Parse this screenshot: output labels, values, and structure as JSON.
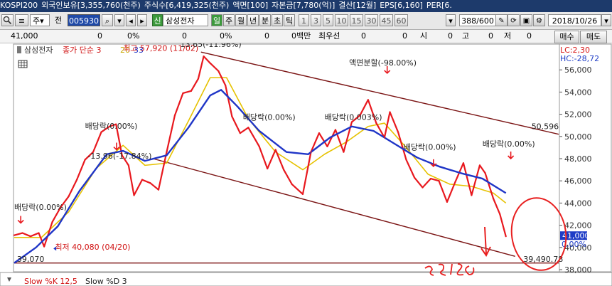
{
  "title_bar": {
    "segments": [
      "KOSPI200",
      "외국인보유[3,355,760(천주)",
      "주식수[6,419,325(천주)",
      "액면[100]",
      "자본금[7,780(억)]",
      "결산[12월]",
      "EPS[6,160]",
      "PER[6."
    ]
  },
  "toolbar": {
    "market_label": "주",
    "full_label": "전",
    "stock_code": "005930",
    "shin_badge": "신",
    "stock_name": "삼성전자",
    "periods": [
      "일",
      "주",
      "월",
      "년",
      "분",
      "초",
      "틱"
    ],
    "intervals": [
      "1",
      "3",
      "5",
      "10",
      "15",
      "30",
      "45",
      "60"
    ],
    "count": "388",
    "count_total": "/600",
    "date": "2018/10/26"
  },
  "quote_row": {
    "price": "41,000",
    "change": "0",
    "change_pct": "0%",
    "volume": "0",
    "volume_pct": "0%",
    "v2": "0",
    "amount": "0백만",
    "best_ask_label": "최우선",
    "best_ask": "0",
    "v3": "0",
    "open_label": "시",
    "open": "0",
    "high_label": "고",
    "high": "0",
    "low_label": "저",
    "low": "0",
    "buy_label": "매수",
    "sell_label": "매도"
  },
  "colors": {
    "price_line": "#e8181e",
    "ma20": "#e6c200",
    "ma33": "#1f35c7",
    "channel": "#7b1414",
    "annotation_red": "#e8181e",
    "lc": "#d81818",
    "hc": "#1e3cc6",
    "ink": "#e82020"
  },
  "chart_data": {
    "type": "line",
    "legend": {
      "name": "삼성전자",
      "series": "종가 단순 3",
      "ma_a": "20",
      "ma_b": "33"
    },
    "corner": {
      "lc": "LC:2,30",
      "hc": "HC:-28,72"
    },
    "y_ticks": [
      "56,000",
      "54,000",
      "52,000",
      "50,000",
      "48,000",
      "46,000",
      "44,000",
      "42,000",
      "40,000",
      "38,000"
    ],
    "current_price_tag": "41,000",
    "current_pct_tag": "0.00%",
    "x_range": [
      0,
      100
    ],
    "y_range": [
      38000,
      58000
    ],
    "close": [
      [
        0,
        41100
      ],
      [
        1.5,
        41300
      ],
      [
        3,
        41000
      ],
      [
        4.5,
        41300
      ],
      [
        5.5,
        40080
      ],
      [
        7,
        42300
      ],
      [
        8.5,
        43600
      ],
      [
        10,
        44600
      ],
      [
        11.5,
        46100
      ],
      [
        13,
        47900
      ],
      [
        14.5,
        48600
      ],
      [
        16,
        50400
      ],
      [
        17.5,
        50900
      ],
      [
        18.7,
        51100
      ],
      [
        19.8,
        48300
      ],
      [
        21,
        47400
      ],
      [
        22,
        44700
      ],
      [
        23.5,
        46100
      ],
      [
        25,
        45800
      ],
      [
        26.5,
        45200
      ],
      [
        28,
        48600
      ],
      [
        29.5,
        51900
      ],
      [
        31,
        53900
      ],
      [
        32.5,
        54100
      ],
      [
        33.8,
        55200
      ],
      [
        34.8,
        57220
      ],
      [
        36,
        56600
      ],
      [
        37.5,
        55900
      ],
      [
        38.8,
        54600
      ],
      [
        40,
        51800
      ],
      [
        41.5,
        50300
      ],
      [
        43,
        50800
      ],
      [
        45,
        49100
      ],
      [
        46.5,
        47100
      ],
      [
        48,
        48800
      ],
      [
        49.5,
        47000
      ],
      [
        51,
        45700
      ],
      [
        53,
        44800
      ],
      [
        54.5,
        48600
      ],
      [
        56,
        50300
      ],
      [
        57.5,
        49100
      ],
      [
        59,
        50600
      ],
      [
        60.5,
        48600
      ],
      [
        62,
        51300
      ],
      [
        63.5,
        51900
      ],
      [
        65,
        53300
      ],
      [
        66.5,
        51200
      ],
      [
        68,
        49900
      ],
      [
        69,
        52200
      ],
      [
        70.5,
        50400
      ],
      [
        72,
        47900
      ],
      [
        73.5,
        46300
      ],
      [
        75,
        45400
      ],
      [
        76.5,
        46200
      ],
      [
        78,
        46000
      ],
      [
        79.5,
        44100
      ],
      [
        81,
        45900
      ],
      [
        82.5,
        47600
      ],
      [
        84,
        44700
      ],
      [
        85.5,
        47400
      ],
      [
        86.5,
        46700
      ],
      [
        88,
        44400
      ],
      [
        89.2,
        43000
      ],
      [
        90.3,
        41000
      ]
    ],
    "ma20": [
      [
        0,
        40900
      ],
      [
        5,
        40900
      ],
      [
        10,
        43200
      ],
      [
        15,
        47100
      ],
      [
        20,
        49200
      ],
      [
        24,
        47400
      ],
      [
        28,
        47600
      ],
      [
        32,
        51400
      ],
      [
        36,
        55300
      ],
      [
        39,
        55300
      ],
      [
        43,
        51600
      ],
      [
        48,
        48600
      ],
      [
        53,
        47000
      ],
      [
        57,
        48400
      ],
      [
        61,
        49500
      ],
      [
        65,
        50900
      ],
      [
        68,
        51200
      ],
      [
        72,
        49000
      ],
      [
        76,
        46600
      ],
      [
        80,
        45700
      ],
      [
        84,
        45500
      ],
      [
        88,
        44900
      ],
      [
        90.3,
        44000
      ]
    ],
    "ma33": [
      [
        0,
        38600
      ],
      [
        4,
        40000
      ],
      [
        8,
        41900
      ],
      [
        12,
        45100
      ],
      [
        17,
        48400
      ],
      [
        20,
        48700
      ],
      [
        24,
        47800
      ],
      [
        28,
        48300
      ],
      [
        32,
        50800
      ],
      [
        36,
        53700
      ],
      [
        38,
        54200
      ],
      [
        41,
        52700
      ],
      [
        45,
        50500
      ],
      [
        50,
        48600
      ],
      [
        54,
        48400
      ],
      [
        58,
        49900
      ],
      [
        62,
        50900
      ],
      [
        66,
        50500
      ],
      [
        70,
        49300
      ],
      [
        74,
        48100
      ],
      [
        78,
        47300
      ],
      [
        82,
        46700
      ],
      [
        86,
        46200
      ],
      [
        90.3,
        44900
      ]
    ],
    "channel_upper": [
      [
        34.3,
        57600
      ],
      [
        100,
        50200
      ]
    ],
    "channel_lower_a": [
      [
        25.5,
        48000
      ],
      [
        92,
        39200
      ]
    ],
    "channel_lower_b": [
      [
        0,
        38600
      ],
      [
        100,
        38600
      ]
    ],
    "annotations": [
      {
        "text": "최고 57,920 (11/02)",
        "x": 20,
        "y": 57700
      },
      {
        "text": "13.65(-11.96%)",
        "x": 30.5,
        "y": 58050
      },
      {
        "text": "배당락(0.00%)",
        "x": 13,
        "y": 50700
      },
      {
        "text": "-13.96(-17.84%)",
        "x": 13.5,
        "y": 48000
      },
      {
        "text": "배당락(0.00%)",
        "x": 0,
        "y": 43400
      },
      {
        "text": "최저 40,080 (04/20)",
        "x": 7.5,
        "y": 39800
      },
      {
        "text": "39,070",
        "x": 0.5,
        "y": 38700
      },
      {
        "text": "액면분할(-98.00%)",
        "x": 61.5,
        "y": 56400
      },
      {
        "text": "배당락(0.00%)",
        "x": 42,
        "y": 51500
      },
      {
        "text": "배당락(0.003%)",
        "x": 57,
        "y": 51500
      },
      {
        "text": "배당락(0.00%)",
        "x": 71.5,
        "y": 48800
      },
      {
        "text": "배당락(0.00%)",
        "x": 86,
        "y": 49100
      },
      {
        "text": "50.596",
        "x": 95,
        "y": 50650
      },
      {
        "text": "39,490.78",
        "x": 93.5,
        "y": 38700
      }
    ],
    "arrows_down": [
      [
        1.2,
        42200
      ],
      [
        18.8,
        48800
      ],
      [
        68.5,
        55700
      ],
      [
        77,
        47300
      ],
      [
        91.2,
        48000
      ]
    ],
    "lower_panel": {
      "label_a": "Slow %K 12,5",
      "label_b": "Slow %D 3"
    }
  }
}
